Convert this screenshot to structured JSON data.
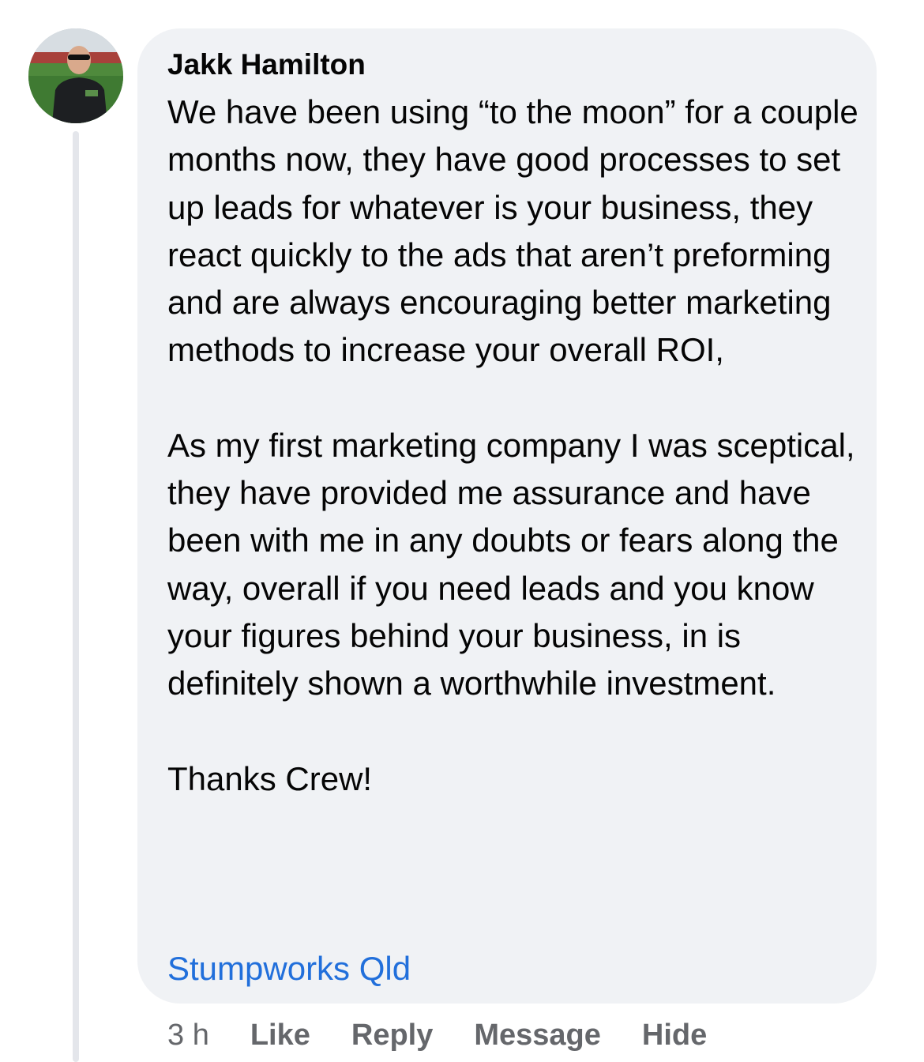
{
  "comment": {
    "author": "Jakk Hamilton",
    "paragraphs": [
      "We have been using “to the moon” for a couple months now, they have good processes to set up leads for whatever is your business, they react quickly to the ads that aren’t preforming and are always encouraging better marketing methods to increase your overall ROI,",
      "As my first marketing company I was sceptical, they have provided me assurance and have been with me in any doubts or fears along the way, overall if you need leads and you know your figures behind your business, in is definitely shown a worthwhile investment.",
      "Thanks Crew!"
    ],
    "tagged_page": "Stumpworks Qld",
    "timestamp": "3 h",
    "actions": {
      "like": "Like",
      "reply": "Reply",
      "message": "Message",
      "hide": "Hide"
    }
  },
  "colors": {
    "bubble_bg": "#f0f2f5",
    "link": "#216fdb",
    "meta_text": "#65676b",
    "thread_line": "#e4e6eb"
  }
}
